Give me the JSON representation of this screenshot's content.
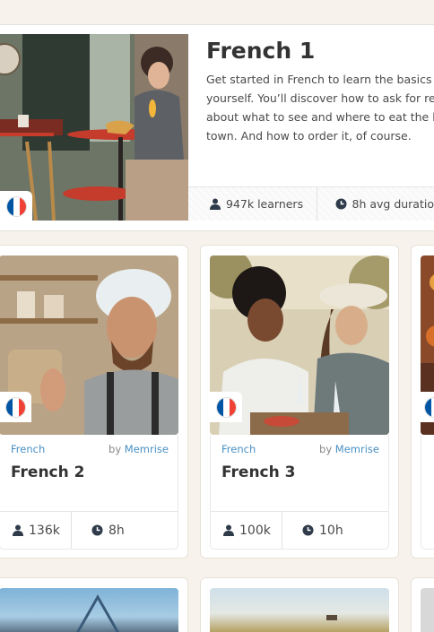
{
  "featured": {
    "title": "French 1",
    "description_lines": [
      "Get started in French to learn the basics ar",
      "yourself. You’ll discover how to ask for rec",
      "about what to see and where to eat the be",
      "town. And how to order it, of course."
    ],
    "learners": "947k learners",
    "duration": "8h avg duratio",
    "flag_icon": "france-flag-icon"
  },
  "cards": [
    {
      "category": "French",
      "by_prefix": "by",
      "brand": "Memrise",
      "title": "French 2",
      "learners": "136k",
      "duration": "8h",
      "flag_icon": "france-flag-icon"
    },
    {
      "category": "French",
      "by_prefix": "by",
      "brand": "Memrise",
      "title": "French 3",
      "learners": "100k",
      "duration": "10h",
      "flag_icon": "france-flag-icon"
    }
  ],
  "colors": {
    "accent_link": "#4a90c4",
    "page_background": "#f7f3ec",
    "flag_blue": "#0055a4",
    "flag_red": "#ef4135"
  }
}
